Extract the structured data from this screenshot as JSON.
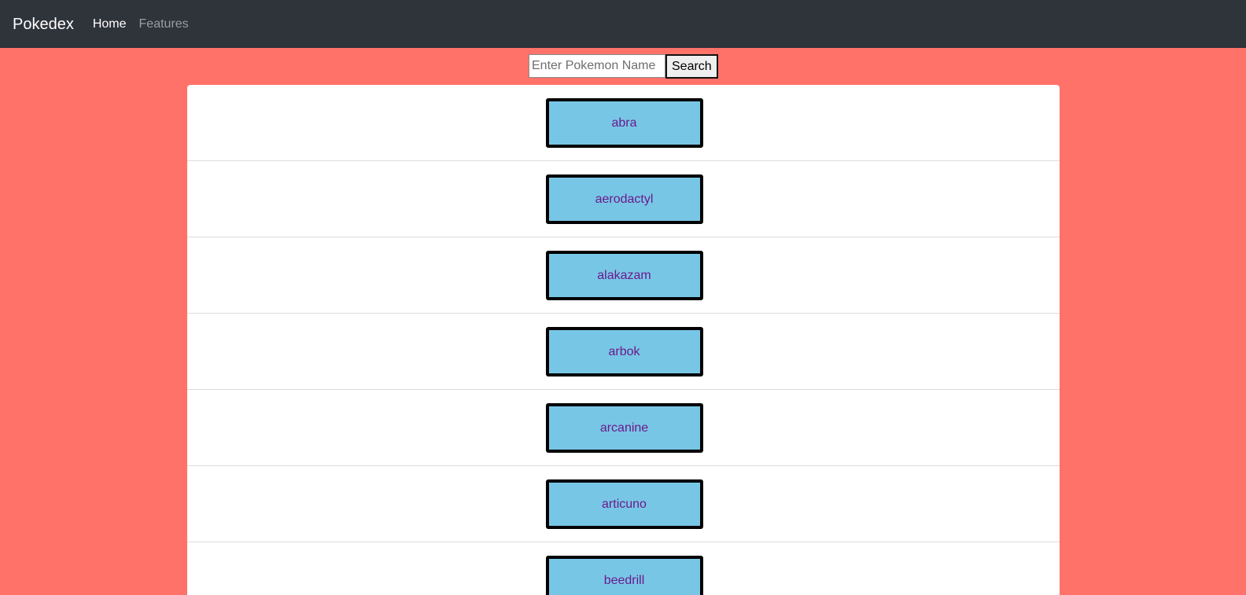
{
  "navbar": {
    "brand": "Pokedex",
    "links": [
      {
        "label": "Home",
        "active": true
      },
      {
        "label": "Features",
        "active": false
      }
    ]
  },
  "search": {
    "placeholder": "Enter Pokemon Name",
    "value": "",
    "button_label": "Search"
  },
  "pokemon": [
    {
      "name": "abra"
    },
    {
      "name": "aerodactyl"
    },
    {
      "name": "alakazam"
    },
    {
      "name": "arbok"
    },
    {
      "name": "arcanine"
    },
    {
      "name": "articuno"
    },
    {
      "name": "beedrill"
    }
  ],
  "colors": {
    "page_background": "#ff7269",
    "navbar_background": "#2f333a",
    "card_background": "#78c6e6",
    "card_border": "#000000",
    "card_text": "#6a1a8c"
  }
}
